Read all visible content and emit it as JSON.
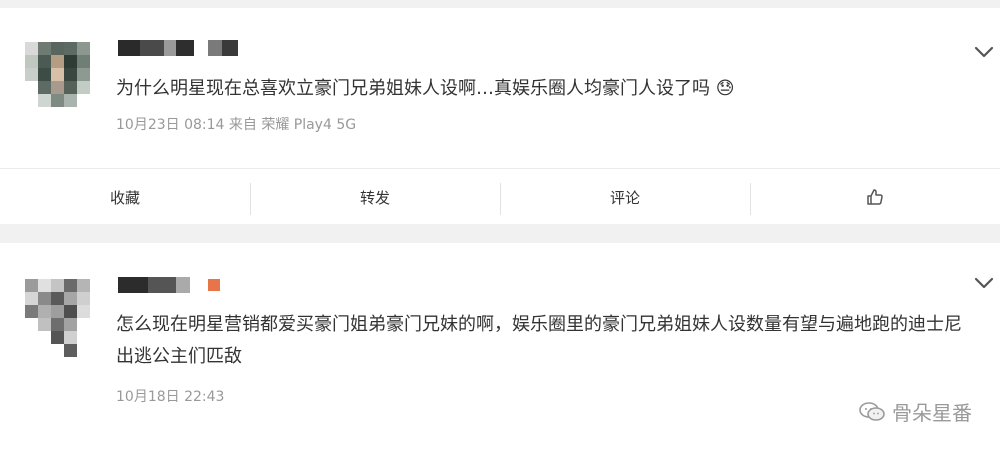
{
  "post1": {
    "content": "为什么明星现在总喜欢立豪门兄弟姐妹人设啊…真娱乐圈人均豪门人设了吗",
    "emoji": "😓",
    "meta": "10月23日 08:14  来自 荣耀 Play4 5G"
  },
  "actions": {
    "favorite": "收藏",
    "repost": "转发",
    "comment": "评论",
    "like_icon": "thumbs-up-icon"
  },
  "post2": {
    "content": "怎么现在明星营销都爱买豪门姐弟豪门兄妹的啊，娱乐圈里的豪门兄弟姐妹人设数量有望与遍地跑的迪士尼出逃公主们匹敌",
    "meta": "10月18日 22:43"
  },
  "watermark": {
    "text": "骨朵星番"
  }
}
